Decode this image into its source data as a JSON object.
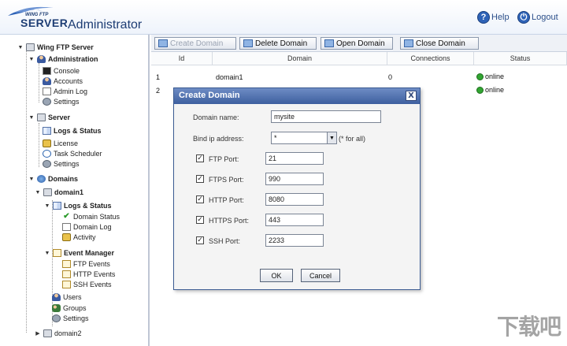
{
  "header": {
    "logo_wing": "WING FTP",
    "logo_server": "SERVER",
    "title": "Administrator",
    "help_label": "Help",
    "logout_label": "Logout"
  },
  "sidebar": {
    "root": "Wing FTP Server",
    "administration": "Administration",
    "admin_items": [
      "Console",
      "Accounts",
      "Admin Log",
      "Settings"
    ],
    "server": "Server",
    "server_items": [
      "Logs & Status",
      "License",
      "Task Scheduler",
      "Settings"
    ],
    "domains": "Domains",
    "domain1": "domain1",
    "logs_status": "Logs & Status",
    "logs_items": [
      "Domain Status",
      "Domain Log",
      "Activity"
    ],
    "event_manager": "Event Manager",
    "event_items": [
      "FTP Events",
      "HTTP Events",
      "SSH Events"
    ],
    "domain_items": [
      "Users",
      "Groups",
      "Settings"
    ],
    "domain2": "domain2"
  },
  "toolbar": {
    "create": "Create Domain",
    "delete": "Delete Domain",
    "open": "Open Domain",
    "close": "Close Domain"
  },
  "grid": {
    "columns": [
      "Id",
      "Domain",
      "Connections",
      "Status"
    ],
    "rows": [
      {
        "id": "1",
        "domain": "domain1",
        "connections": "0",
        "status": "online"
      },
      {
        "id": "2",
        "domain": "",
        "connections": "",
        "status": "online"
      }
    ]
  },
  "dialog": {
    "title": "Create Domain",
    "close": "X",
    "domain_name_label": "Domain name:",
    "domain_name_value": "mysite",
    "bind_ip_label": "Bind ip address:",
    "bind_ip_value": "*",
    "bind_ip_hint": "(* for all)",
    "ports": [
      {
        "label": "FTP Port:",
        "value": "21",
        "checked": true
      },
      {
        "label": "FTPS Port:",
        "value": "990",
        "checked": true
      },
      {
        "label": "HTTP Port:",
        "value": "8080",
        "checked": true
      },
      {
        "label": "HTTPS Port:",
        "value": "443",
        "checked": true
      },
      {
        "label": "SSH Port:",
        "value": "2233",
        "checked": true
      }
    ],
    "ok": "OK",
    "cancel": "Cancel"
  },
  "watermark": "下载吧"
}
